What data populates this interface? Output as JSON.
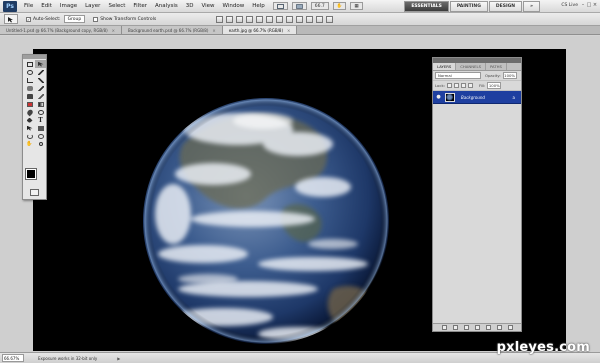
{
  "app": {
    "logo_text": "Ps"
  },
  "menubar": {
    "items": [
      "File",
      "Edit",
      "Image",
      "Layer",
      "Select",
      "Filter",
      "Analysis",
      "3D",
      "View",
      "Window",
      "Help"
    ],
    "zoom_select": "66.7",
    "workspaces": [
      "ESSENTIALS",
      "PAINTING",
      "DESIGN"
    ],
    "more_button": "»",
    "cs_live": "CS Live",
    "window_controls": [
      "–",
      "□",
      "×"
    ]
  },
  "options": {
    "auto_select_label": "Auto-Select:",
    "auto_select_value": "Group",
    "show_transform_label": "Show Transform Controls"
  },
  "tabs": [
    {
      "label": "Untitled-1.psd @ 66.7% (Background copy, RGB/8)"
    },
    {
      "label": "Background earth.psd @ 66.7% (RGB/8)"
    },
    {
      "label": "earth.jpg @ 66.7% (RGB/8)"
    }
  ],
  "layers_panel": {
    "tabs": [
      "LAYERS",
      "CHANNELS",
      "PATHS"
    ],
    "blend_mode": "Normal",
    "opacity_label": "Opacity:",
    "opacity_value": "100%",
    "lock_label": "Lock:",
    "fill_label": "Fill:",
    "fill_value": "100%",
    "layer_name": "Background",
    "layer_lock": "a"
  },
  "status": {
    "zoom": "66.67%",
    "info": "Exposure works in 32-bit only",
    "arrow": "▶"
  },
  "watermark": "pxleyes.com",
  "colors": {
    "foreground": "#000000",
    "background": "#ffffff",
    "selected_layer": "#1e3fa0"
  }
}
